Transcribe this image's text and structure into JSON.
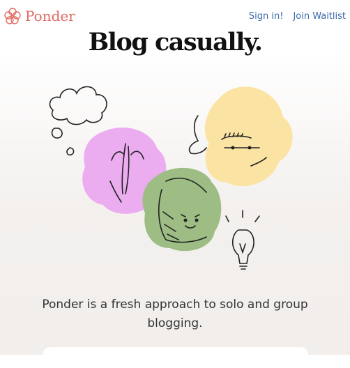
{
  "brand": {
    "name": "Ponder",
    "icon": "flower-logo-icon",
    "color": "#e06a62"
  },
  "nav": {
    "sign_in": "Sign in!",
    "join_waitlist": "Join Waitlist",
    "link_color": "#3d6ca8"
  },
  "hero": {
    "headline": "Blog casually.",
    "tagline": "Ponder is a fresh approach to solo and group blogging."
  },
  "illustration": {
    "icons": [
      "thought-cloud-icon",
      "pink-face-icon",
      "yellow-face-icon",
      "green-face-icon",
      "lightbulb-icon"
    ],
    "colors": {
      "pink": "#ecacf0",
      "yellow": "#fbe3a3",
      "green": "#9dbd84"
    }
  }
}
